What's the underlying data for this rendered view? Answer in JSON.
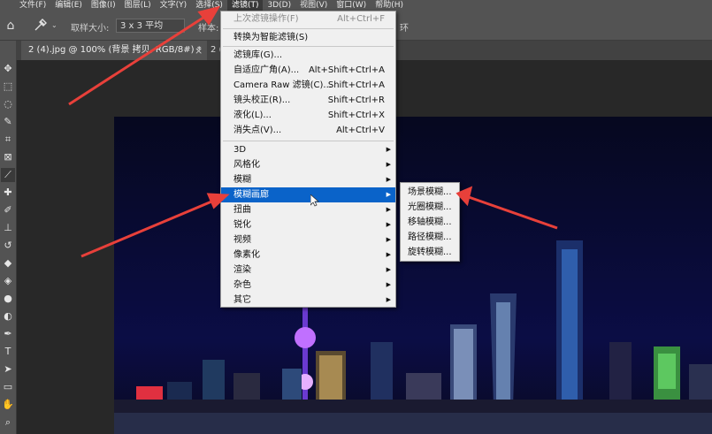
{
  "menubar": {
    "items": [
      "文件(F)",
      "编辑(E)",
      "图像(I)",
      "图层(L)",
      "文字(Y)",
      "选择(S)",
      "滤镜(T)",
      "3D(D)",
      "视图(V)",
      "窗口(W)",
      "帮助(H)"
    ]
  },
  "options": {
    "sample_size_label": "取样大小:",
    "sample_size_value": "3 x 3 平均",
    "sample_label_partial": "样本:",
    "ring_label_partial": "环"
  },
  "tabs": [
    {
      "label": "2 (4).jpg @ 100% (背景 拷贝, RGB/8#) *"
    },
    {
      "label": "2 (6).j"
    }
  ],
  "filter_menu": {
    "last_filter": {
      "label": "上次滤镜操作(F)",
      "shortcut": "Alt+Ctrl+F"
    },
    "convert_smart": {
      "label": "转换为智能滤镜(S)"
    },
    "items_a": [
      {
        "label": "滤镜库(G)...",
        "shortcut": ""
      },
      {
        "label": "自适应广角(A)...",
        "shortcut": "Alt+Shift+Ctrl+A"
      },
      {
        "label": "Camera Raw 滤镜(C)...",
        "shortcut": "Shift+Ctrl+A"
      },
      {
        "label": "镜头校正(R)...",
        "shortcut": "Shift+Ctrl+R"
      },
      {
        "label": "液化(L)...",
        "shortcut": "Shift+Ctrl+X"
      },
      {
        "label": "消失点(V)...",
        "shortcut": "Alt+Ctrl+V"
      }
    ],
    "items_b": [
      {
        "label": "3D"
      },
      {
        "label": "风格化"
      },
      {
        "label": "模糊"
      },
      {
        "label": "模糊画廊"
      },
      {
        "label": "扭曲"
      },
      {
        "label": "锐化"
      },
      {
        "label": "视频"
      },
      {
        "label": "像素化"
      },
      {
        "label": "渲染"
      },
      {
        "label": "杂色"
      },
      {
        "label": "其它"
      }
    ]
  },
  "blur_gallery_submenu": [
    "场景模糊...",
    "光圈模糊...",
    "移轴模糊...",
    "路径模糊...",
    "旋转模糊..."
  ],
  "colors": {
    "highlight": "#0a63c9",
    "annotation_arrow": "#e8403a"
  },
  "icons": {
    "submenu_arrow": "▶",
    "close": "×",
    "home": "⌂"
  }
}
